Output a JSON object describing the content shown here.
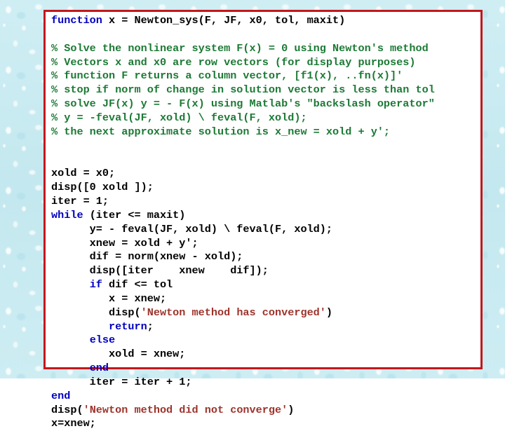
{
  "slide": {
    "background_color": "#c9eaf1",
    "background_texture": "water-droplets",
    "panel_background": "#ffffff",
    "panel_border_color": "#c4171b"
  },
  "code": {
    "language": "MATLAB",
    "function_name": "Newton_sys",
    "colors": {
      "default": "#000000",
      "keyword": "#0000c0",
      "comment": "#1c7a35",
      "string": "#9e332b"
    },
    "lines": [
      [
        {
          "t": "function",
          "c": "kw"
        },
        {
          "t": " x = Newton_sys(F, JF, x0, tol, maxit)",
          "c": ""
        }
      ],
      [],
      [
        {
          "t": "% Solve the nonlinear system F(x) = 0 using Newton's method",
          "c": "cmt"
        }
      ],
      [
        {
          "t": "% Vectors x and x0 are row vectors (for display purposes)",
          "c": "cmt"
        }
      ],
      [
        {
          "t": "% function F returns a column vector, [f1(x), ..fn(x)]'",
          "c": "cmt"
        }
      ],
      [
        {
          "t": "% stop if norm of change in solution vector is less than tol",
          "c": "cmt"
        }
      ],
      [
        {
          "t": "% solve JF(x) y = - F(x) using Matlab's \"backslash operator\"",
          "c": "cmt"
        }
      ],
      [
        {
          "t": "% y = -feval(JF, xold) \\ feval(F, xold);",
          "c": "cmt"
        }
      ],
      [
        {
          "t": "% the next approximate solution is x_new = xold + y';",
          "c": "cmt"
        }
      ],
      [],
      [],
      [
        {
          "t": "xold = x0;",
          "c": ""
        }
      ],
      [
        {
          "t": "disp([0 xold ]);",
          "c": ""
        }
      ],
      [
        {
          "t": "iter = 1;",
          "c": ""
        }
      ],
      [
        {
          "t": "while",
          "c": "kw"
        },
        {
          "t": " (iter <= maxit)",
          "c": ""
        }
      ],
      [
        {
          "t": "      y= - feval(JF, xold) \\ feval(F, xold);",
          "c": ""
        }
      ],
      [
        {
          "t": "      xnew = xold + y';",
          "c": ""
        }
      ],
      [
        {
          "t": "      dif = norm(xnew - xold);",
          "c": ""
        }
      ],
      [
        {
          "t": "      disp([iter    xnew    dif]);",
          "c": ""
        }
      ],
      [
        {
          "t": "      ",
          "c": ""
        },
        {
          "t": "if",
          "c": "kw"
        },
        {
          "t": " dif <= tol",
          "c": ""
        }
      ],
      [
        {
          "t": "         x = xnew;",
          "c": ""
        }
      ],
      [
        {
          "t": "         disp(",
          "c": ""
        },
        {
          "t": "'Newton method has converged'",
          "c": "str"
        },
        {
          "t": ")",
          "c": ""
        }
      ],
      [
        {
          "t": "         ",
          "c": ""
        },
        {
          "t": "return",
          "c": "kw"
        },
        {
          "t": ";",
          "c": ""
        }
      ],
      [
        {
          "t": "      ",
          "c": ""
        },
        {
          "t": "else",
          "c": "kw"
        }
      ],
      [
        {
          "t": "         xold = xnew;",
          "c": ""
        }
      ],
      [
        {
          "t": "      ",
          "c": ""
        },
        {
          "t": "end",
          "c": "kw"
        }
      ],
      [
        {
          "t": "      iter = iter + 1;",
          "c": ""
        }
      ],
      [
        {
          "t": "end",
          "c": "kw"
        }
      ],
      [
        {
          "t": "disp(",
          "c": ""
        },
        {
          "t": "'Newton method did not converge'",
          "c": "str"
        },
        {
          "t": ")",
          "c": ""
        }
      ],
      [
        {
          "t": "x=xnew;",
          "c": ""
        }
      ]
    ]
  }
}
